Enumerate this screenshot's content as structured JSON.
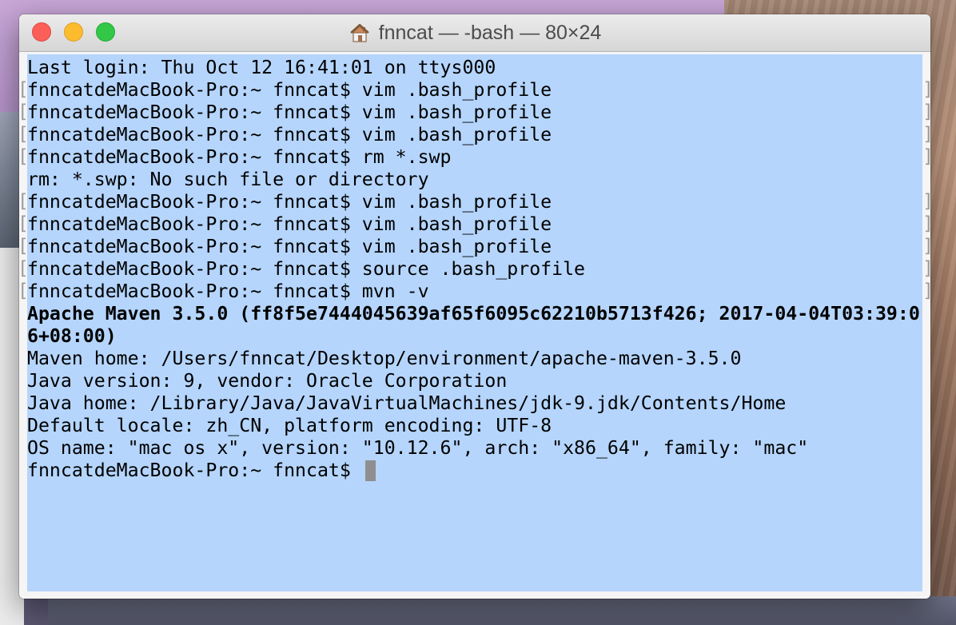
{
  "window": {
    "title": "fnncat — -bash — 80×24",
    "title_icon": "home-icon"
  },
  "terminal": {
    "lines": [
      {
        "text": "Last login: Thu Oct 12 16:41:01 on ttys000",
        "bold": false,
        "marks": false
      },
      {
        "text": "fnncatdeMacBook-Pro:~ fnncat$ vim .bash_profile",
        "bold": false,
        "marks": true
      },
      {
        "text": "fnncatdeMacBook-Pro:~ fnncat$ vim .bash_profile",
        "bold": false,
        "marks": true
      },
      {
        "text": "fnncatdeMacBook-Pro:~ fnncat$ vim .bash_profile",
        "bold": false,
        "marks": true
      },
      {
        "text": "fnncatdeMacBook-Pro:~ fnncat$ rm *.swp",
        "bold": false,
        "marks": true
      },
      {
        "text": "rm: *.swp: No such file or directory",
        "bold": false,
        "marks": false
      },
      {
        "text": "fnncatdeMacBook-Pro:~ fnncat$ vim .bash_profile",
        "bold": false,
        "marks": true
      },
      {
        "text": "fnncatdeMacBook-Pro:~ fnncat$ vim .bash_profile",
        "bold": false,
        "marks": true
      },
      {
        "text": "fnncatdeMacBook-Pro:~ fnncat$ vim .bash_profile",
        "bold": false,
        "marks": true
      },
      {
        "text": "fnncatdeMacBook-Pro:~ fnncat$ source .bash_profile",
        "bold": false,
        "marks": true
      },
      {
        "text": "fnncatdeMacBook-Pro:~ fnncat$ mvn -v",
        "bold": false,
        "marks": true
      },
      {
        "text": "Apache Maven 3.5.0 (ff8f5e7444045639af65f6095c62210b5713f426; 2017-04-04T03:39:0",
        "bold": true,
        "marks": false
      },
      {
        "text": "6+08:00)",
        "bold": true,
        "marks": false
      },
      {
        "text": "Maven home: /Users/fnncat/Desktop/environment/apache-maven-3.5.0",
        "bold": false,
        "marks": false
      },
      {
        "text": "Java version: 9, vendor: Oracle Corporation",
        "bold": false,
        "marks": false
      },
      {
        "text": "Java home: /Library/Java/JavaVirtualMachines/jdk-9.jdk/Contents/Home",
        "bold": false,
        "marks": false
      },
      {
        "text": "Default locale: zh_CN, platform encoding: UTF-8",
        "bold": false,
        "marks": false
      },
      {
        "text": "OS name: \"mac os x\", version: \"10.12.6\", arch: \"x86_64\", family: \"mac\"",
        "bold": false,
        "marks": false
      }
    ],
    "prompt": "fnncatdeMacBook-Pro:~ fnncat$ ",
    "colors": {
      "selection_bg": "#b5d5fc",
      "cursor": "#8f8f8f"
    }
  }
}
